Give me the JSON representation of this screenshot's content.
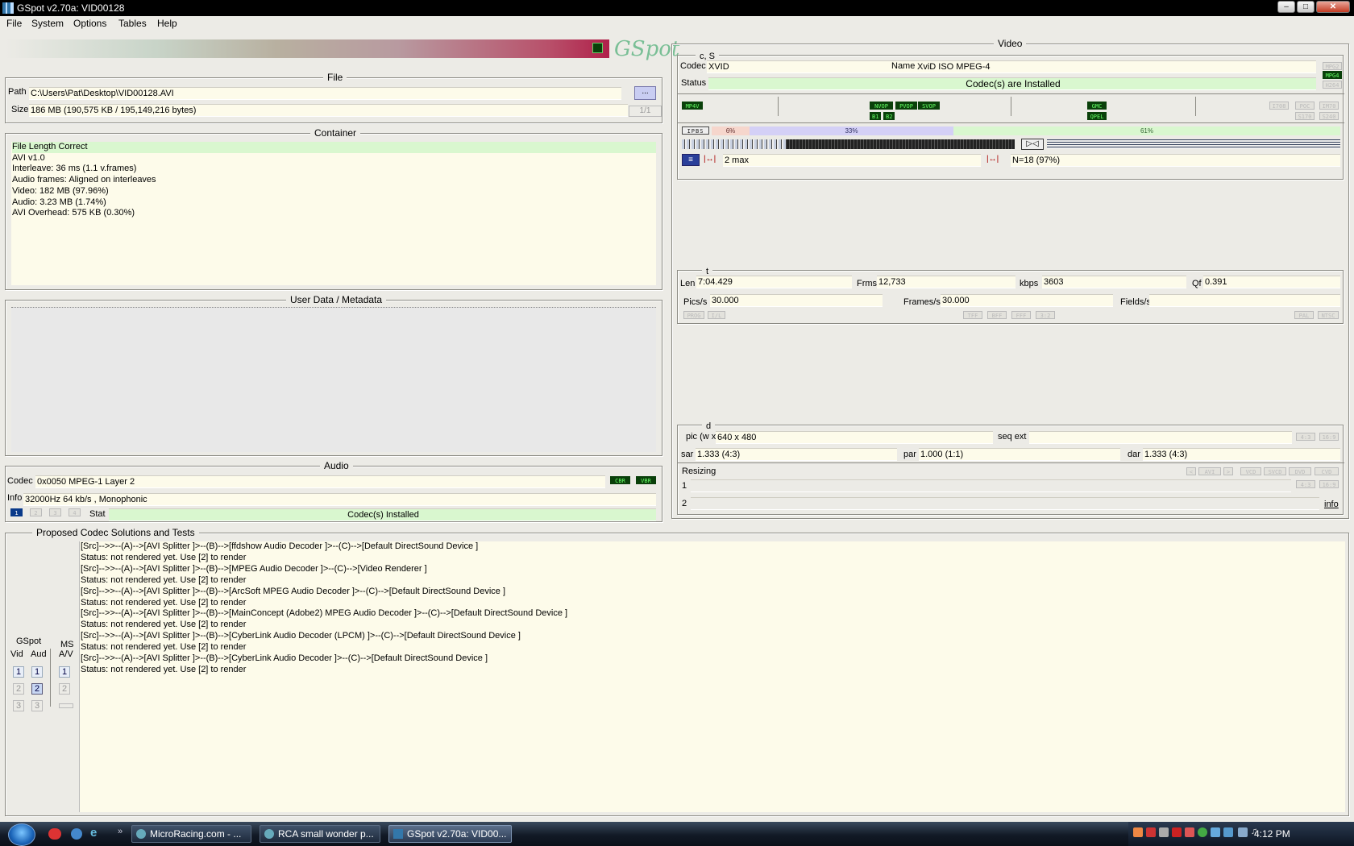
{
  "window": {
    "title": "GSpot v2.70a: VID00128"
  },
  "menu": [
    "File",
    "System",
    "Options",
    "Tables",
    "Help"
  ],
  "logo": "GSpot",
  "file": {
    "title": "File",
    "path_label": "Path",
    "path": "C:\\Users\\Pat\\Desktop\\VID00128.AVI",
    "browse": "...",
    "size_label": "Size",
    "size": "186 MB (190,575 KB / 195,149,216 bytes)",
    "page": "1/1"
  },
  "container": {
    "title": "Container",
    "lines": [
      "File Length Correct",
      "AVI v1.0",
      "Interleave: 36 ms (1.1 v.frames)",
      "Audio frames: Aligned on interleaves",
      "Video: 182 MB (97.96%)",
      "Audio: 3.23 MB (1.74%)",
      "AVI Overhead: 575 KB (0.30%)"
    ]
  },
  "userdata": {
    "title": "User Data / Metadata"
  },
  "audio": {
    "title": "Audio",
    "codec_label": "Codec",
    "codec": "0x0050  MPEG-1 Layer 2",
    "cbr": "CBR",
    "vbr": "VBR",
    "info_label": "Info",
    "info": "32000Hz  64 kb/s , Monophonic",
    "tracks": [
      "1",
      "2",
      "3",
      "4"
    ],
    "stat_label": "Stat",
    "stat": "Codec(s) Installed"
  },
  "video": {
    "title": "Video",
    "cs_label": "c, S",
    "codec_label": "Codec",
    "codec": "XVID",
    "name_label": "Name",
    "name": "XviD ISO MPEG-4",
    "status_label": "Status",
    "status": "Codec(s) are Installed",
    "side_tags": [
      "MPG2",
      "MPG4",
      "H264"
    ],
    "row_tags": {
      "left": "MP4V",
      "mid1": [
        "NVOP",
        "PVOP",
        "SVOP"
      ],
      "mid2": [
        "B1",
        "B2"
      ],
      "right1": "GMC",
      "right2": "QPEL",
      "far": [
        "I708",
        "POC",
        "IM70",
        "S170",
        "S240"
      ]
    },
    "frame_types": "IPBS",
    "pct1": "6%",
    "pct2": "33%",
    "pct3": "61%",
    "bmax": "2 max",
    "nval": "N=18 (97%)",
    "t_label": "t",
    "len_label": "Len",
    "len": "7:04.429",
    "frms_label": "Frms",
    "frms": "12,733",
    "kbps_label": "kbps",
    "kbps": "3603",
    "qf_label": "Qf",
    "qf": "0.391",
    "pics_label": "Pics/s",
    "pics": "30.000",
    "frames_label": "Frames/s",
    "frames": "30.000",
    "fields_label": "Fields/s",
    "scan_tags": [
      "PROG",
      "I/L"
    ],
    "field_tags": [
      "TFF",
      "BFF",
      "FFF",
      "3:2"
    ],
    "std_tags": [
      "PAL",
      "NTSC"
    ],
    "d_label": "d",
    "pic_label": "pic (w x",
    "pic": "640 x 480",
    "seqext_label": "seq ext",
    "ar_tags": [
      "4:3",
      "16:9"
    ],
    "sar_label": "sar",
    "sar": "1.333 (4:3)",
    "par_label": "par",
    "par": "1.000 (1:1)",
    "dar_label": "dar",
    "dar": "1.333 (4:3)",
    "resizing_label": "Resizing",
    "resize_tags": [
      "<",
      "AVI",
      ">",
      "VCD",
      "SVCD",
      "DVD",
      "CVD"
    ],
    "resize_ar": [
      "4:3",
      "16:9"
    ],
    "row1": "1",
    "row2": "2",
    "info_link": "info"
  },
  "codecs": {
    "title": "Proposed Codec Solutions and Tests",
    "gspot_label": "GSpot",
    "vid_label": "Vid",
    "aud_label": "Aud",
    "ms_label": "MS",
    "av_label": "A/V",
    "lines": [
      "[Src]-->>--(A)-->[AVI Splitter ]>--(B)-->[ffdshow Audio Decoder ]>--(C)-->[Default DirectSound Device ]",
      "Status: not rendered yet. Use [2] to render",
      "[Src]-->>--(A)-->[AVI Splitter ]>--(B)-->[MPEG Audio Decoder ]>--(C)-->[Video Renderer ]",
      "Status: not rendered yet. Use [2] to render",
      "[Src]-->>--(A)-->[AVI Splitter ]>--(B)-->[ArcSoft MPEG Audio Decoder ]>--(C)-->[Default DirectSound Device ]",
      "Status: not rendered yet. Use [2] to render",
      "[Src]-->>--(A)-->[AVI Splitter ]>--(B)-->[MainConcept (Adobe2) MPEG Audio Decoder ]>--(C)-->[Default DirectSound Device ]",
      "Status: not rendered yet. Use [2] to render",
      "[Src]-->>--(A)-->[AVI Splitter ]>--(B)-->[CyberLink Audio Decoder (LPCM) ]>--(C)-->[Default DirectSound Device ]",
      "Status: not rendered yet. Use [2] to render",
      "[Src]-->>--(A)-->[AVI Splitter ]>--(B)-->[CyberLink Audio Decoder ]>--(C)-->[Default DirectSound Device ]",
      "Status: not rendered yet. Use [2] to render"
    ]
  },
  "taskbar": {
    "items": [
      "MicroRacing.com - ...",
      "RCA small wonder p...",
      "GSpot v2.70a: VID00..."
    ],
    "clock": "4:12 PM"
  }
}
